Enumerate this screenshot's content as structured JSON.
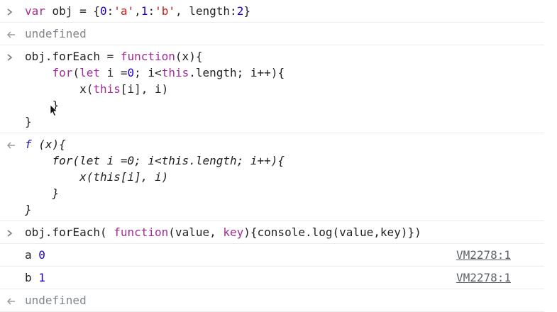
{
  "entries": [
    {
      "kind": "input",
      "lines": [
        [
          {
            "t": "var ",
            "c": "kw"
          },
          {
            "t": "obj = {",
            "c": "plain"
          },
          {
            "t": "0",
            "c": "num"
          },
          {
            "t": ":",
            "c": "plain"
          },
          {
            "t": "'a'",
            "c": "str"
          },
          {
            "t": ",",
            "c": "plain"
          },
          {
            "t": "1",
            "c": "num"
          },
          {
            "t": ":",
            "c": "plain"
          },
          {
            "t": "'b'",
            "c": "str"
          },
          {
            "t": ", length:",
            "c": "plain"
          },
          {
            "t": "2",
            "c": "num"
          },
          {
            "t": "}",
            "c": "plain"
          }
        ]
      ]
    },
    {
      "kind": "result",
      "lines": [
        [
          {
            "t": "undefined",
            "c": "gray"
          }
        ]
      ]
    },
    {
      "kind": "input",
      "lines": [
        [
          {
            "t": "obj.forEach = ",
            "c": "plain"
          },
          {
            "t": "function",
            "c": "kw"
          },
          {
            "t": "(x){",
            "c": "plain"
          }
        ],
        [
          {
            "t": "    ",
            "c": "plain"
          },
          {
            "t": "for",
            "c": "kw"
          },
          {
            "t": "(",
            "c": "plain"
          },
          {
            "t": "let",
            "c": "kw"
          },
          {
            "t": " i =",
            "c": "plain"
          },
          {
            "t": "0",
            "c": "num"
          },
          {
            "t": "; i<",
            "c": "plain"
          },
          {
            "t": "this",
            "c": "kw"
          },
          {
            "t": ".length; i++){",
            "c": "plain"
          }
        ],
        [
          {
            "t": "        x(",
            "c": "plain"
          },
          {
            "t": "this",
            "c": "kw"
          },
          {
            "t": "[i], i)",
            "c": "plain"
          }
        ],
        [
          {
            "t": "    }",
            "c": "plain"
          }
        ],
        [
          {
            "t": "}",
            "c": "plain"
          }
        ]
      ]
    },
    {
      "kind": "result",
      "lines": [
        [
          {
            "t": "f ",
            "c": "fnname"
          },
          {
            "t": "(x){",
            "c": "plain italic"
          }
        ],
        [
          {
            "t": "    for(let i =0; i<this.length; i++){",
            "c": "plain italic"
          }
        ],
        [
          {
            "t": "        x(this[i], i)",
            "c": "plain italic"
          }
        ],
        [
          {
            "t": "    }",
            "c": "plain italic"
          }
        ],
        [
          {
            "t": "}",
            "c": "plain italic"
          }
        ]
      ]
    },
    {
      "kind": "input",
      "lines": [
        [
          {
            "t": "obj.forEach( ",
            "c": "plain"
          },
          {
            "t": "function",
            "c": "kw"
          },
          {
            "t": "(value, ",
            "c": "plain"
          },
          {
            "t": "key",
            "c": "kw"
          },
          {
            "t": "){console.log(value,key)})",
            "c": "plain"
          }
        ]
      ]
    },
    {
      "kind": "log",
      "lines": [
        [
          {
            "t": "a ",
            "c": "plain"
          },
          {
            "t": "0",
            "c": "num"
          }
        ]
      ],
      "source": "VM2278:1"
    },
    {
      "kind": "log",
      "lines": [
        [
          {
            "t": "b ",
            "c": "plain"
          },
          {
            "t": "1",
            "c": "num"
          }
        ]
      ],
      "source": "VM2278:1"
    },
    {
      "kind": "result",
      "lines": [
        [
          {
            "t": "undefined",
            "c": "gray"
          }
        ]
      ]
    }
  ]
}
